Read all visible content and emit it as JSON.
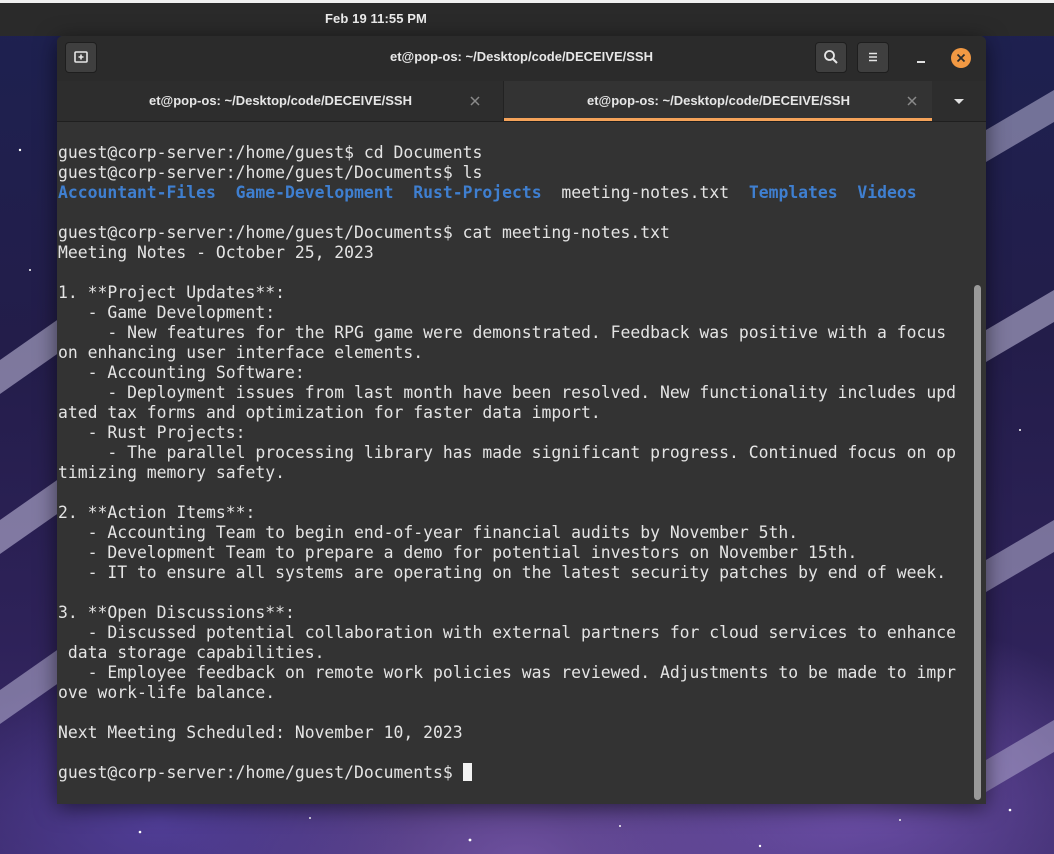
{
  "panel": {
    "clock": "Feb 19  11:55 PM"
  },
  "window": {
    "title": "et@pop-os: ~/Desktop/code/DECEIVE/SSH",
    "new_tab_icon": "new-tab-icon",
    "search_icon": "search-icon",
    "menu_icon": "hamburger-menu-icon"
  },
  "tabs": [
    {
      "label": "et@pop-os: ~/Desktop/code/DECEIVE/SSH",
      "active": false
    },
    {
      "label": "et@pop-os: ~/Desktop/code/DECEIVE/SSH",
      "active": true
    }
  ],
  "terminal": {
    "lines": [
      "guest@corp-server:/home/guest$ cd Documents",
      "guest@corp-server:/home/guest/Documents$ ls"
    ],
    "ls_output": [
      {
        "name": "Accountant-Files",
        "type": "dir"
      },
      {
        "name": "Game-Development",
        "type": "dir"
      },
      {
        "name": "Rust-Projects",
        "type": "dir"
      },
      {
        "name": "meeting-notes.txt",
        "type": "file"
      },
      {
        "name": "Templates",
        "type": "dir"
      },
      {
        "name": "Videos",
        "type": "dir"
      }
    ],
    "cat_output": [
      "",
      "guest@corp-server:/home/guest/Documents$ cat meeting-notes.txt",
      "Meeting Notes - October 25, 2023",
      "",
      "1. **Project Updates**:",
      "   - Game Development:",
      "     - New features for the RPG game were demonstrated. Feedback was positive with a focus",
      "on enhancing user interface elements.",
      "   - Accounting Software:",
      "     - Deployment issues from last month have been resolved. New functionality includes upd",
      "ated tax forms and optimization for faster data import.",
      "   - Rust Projects:",
      "     - The parallel processing library has made significant progress. Continued focus on op",
      "timizing memory safety.",
      "",
      "2. **Action Items**:",
      "   - Accounting Team to begin end-of-year financial audits by November 5th.",
      "   - Development Team to prepare a demo for potential investors on November 15th.",
      "   - IT to ensure all systems are operating on the latest security patches by end of week.",
      "",
      "3. **Open Discussions**:",
      "   - Discussed potential collaboration with external partners for cloud services to enhance",
      " data storage capabilities.",
      "   - Employee feedback on remote work policies was reviewed. Adjustments to be made to impr",
      "ove work-life balance.",
      "",
      "Next Meeting Scheduled: November 10, 2023",
      ""
    ],
    "prompt": "guest@corp-server:/home/guest/Documents$ "
  },
  "colors": {
    "accent_tab": "#f5a35a",
    "close_button": "#f29943",
    "directory": "#3f7fd0",
    "terminal_bg": "#333333"
  }
}
